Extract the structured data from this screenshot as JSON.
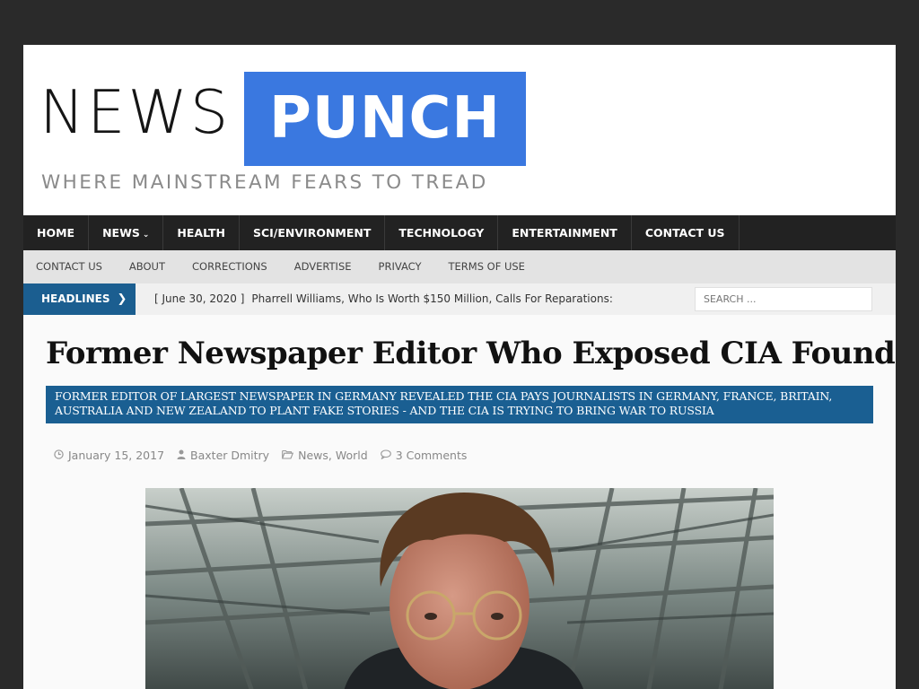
{
  "logo": {
    "part1": "NEWS",
    "part2": "PUNCH",
    "tagline": "WHERE MAINSTREAM FEARS TO TREAD"
  },
  "main_nav": [
    {
      "label": "HOME"
    },
    {
      "label": "NEWS"
    },
    {
      "label": "HEALTH"
    },
    {
      "label": "SCI/ENVIRONMENT"
    },
    {
      "label": "TECHNOLOGY"
    },
    {
      "label": "ENTERTAINMENT"
    },
    {
      "label": "CONTACT US"
    }
  ],
  "sub_nav": [
    {
      "label": "CONTACT US"
    },
    {
      "label": "ABOUT"
    },
    {
      "label": "CORRECTIONS"
    },
    {
      "label": "ADVERTISE"
    },
    {
      "label": "PRIVACY"
    },
    {
      "label": "TERMS OF USE"
    }
  ],
  "ticker": {
    "label": "HEADLINES",
    "date": "[ June 30, 2020 ]",
    "headline": "Pharrell Williams, Who Is Worth $150 Million, Calls For Reparations:"
  },
  "search": {
    "placeholder": "SEARCH ..."
  },
  "article": {
    "title": "Former Newspaper Editor Who Exposed CIA Found Dead",
    "subtitle": "FORMER EDITOR OF LARGEST NEWSPAPER IN GERMANY REVEALED THE CIA PAYS JOURNALISTS IN GERMANY, FRANCE, BRITAIN, AUSTRALIA AND NEW ZEALAND TO PLANT FAKE STORIES - AND THE CIA IS TRYING TO BRING WAR TO RUSSIA",
    "date": "January 15, 2017",
    "author": "Baxter Dmitry",
    "category1": "News",
    "category_sep": ",",
    "category2": "World",
    "comments": "3 Comments"
  },
  "colors": {
    "brand_blue": "#3a78e0",
    "accent_blue": "#1a5f92",
    "nav_bg": "#222222",
    "frame_bg": "#2a2a2a"
  }
}
